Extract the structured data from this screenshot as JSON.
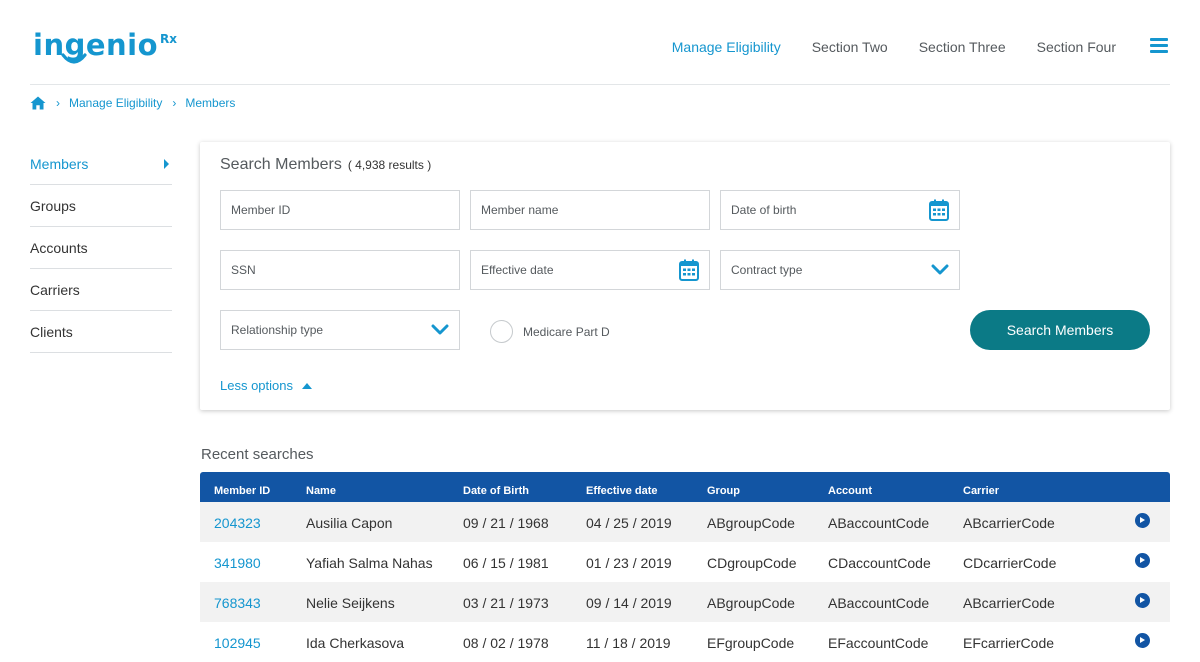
{
  "header": {
    "logo_text": "ingenio",
    "logo_sup": "Rx",
    "nav": [
      "Manage Eligibility",
      "Section Two",
      "Section Three",
      "Section Four"
    ]
  },
  "breadcrumb": [
    "Manage Eligibility",
    "Members"
  ],
  "sidebar": {
    "items": [
      {
        "label": "Members",
        "active": true
      },
      {
        "label": "Groups"
      },
      {
        "label": "Accounts"
      },
      {
        "label": "Carriers"
      },
      {
        "label": "Clients"
      }
    ]
  },
  "search": {
    "title": "Search Members",
    "count": "( 4,938 results )",
    "placeholders": {
      "member_id": "Member ID",
      "member_name": "Member name",
      "dob": "Date of birth",
      "ssn": "SSN",
      "effective_date": "Effective date",
      "contract_type": "Contract type",
      "relationship_type": "Relationship type"
    },
    "medicare_label": "Medicare Part D",
    "button_label": "Search Members",
    "less_options": "Less options"
  },
  "recent": {
    "title": "Recent searches",
    "columns": [
      "Member ID",
      "Name",
      "Date of Birth",
      "Effective date",
      "Group",
      "Account",
      "Carrier"
    ],
    "rows": [
      [
        "204323",
        "Ausilia Capon",
        "09 / 21 / 1968",
        "04 / 25 / 2019",
        "ABgroupCode",
        "ABaccountCode",
        "ABcarrierCode"
      ],
      [
        "341980",
        "Yafiah Salma Nahas",
        "06 / 15 / 1981",
        "01 / 23 / 2019",
        "CDgroupCode",
        "CDaccountCode",
        "CDcarrierCode"
      ],
      [
        "768343",
        "Nelie Seijkens",
        "03 / 21 / 1973",
        "09 / 14 / 2019",
        "ABgroupCode",
        "ABaccountCode",
        "ABcarrierCode"
      ],
      [
        "102945",
        "Ida Cherkasova",
        "08 / 02 / 1978",
        "11 / 18 / 2019",
        "EFgroupCode",
        "EFaccountCode",
        "EFcarrierCode"
      ]
    ]
  },
  "colors": {
    "accent": "#1596cf",
    "table_header": "#1255a4",
    "button": "#0b7a86"
  },
  "icons": [
    "home-icon",
    "calendar-icon",
    "chevron-down-icon",
    "hamburger-icon",
    "arrow-circle-right-icon"
  ]
}
